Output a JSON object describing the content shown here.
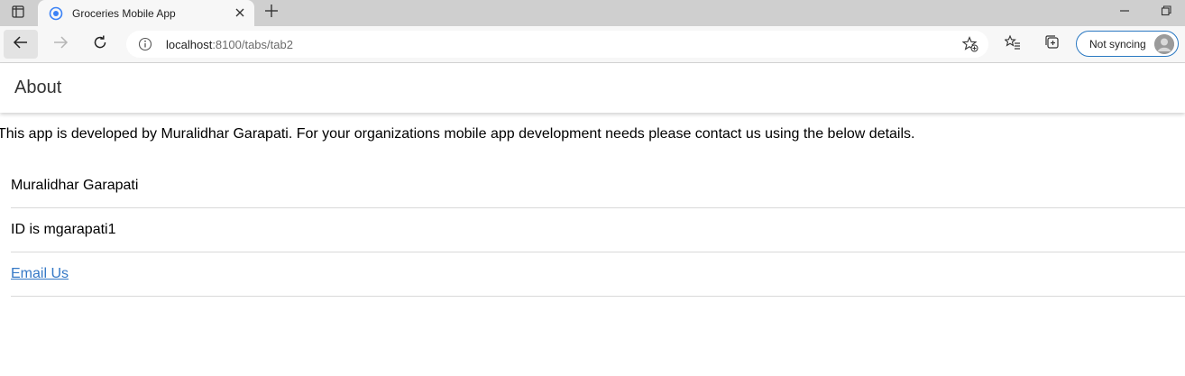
{
  "browser": {
    "tab": {
      "title": "Groceries Mobile App",
      "favicon": "ionic-icon"
    },
    "address": {
      "host": "localhost",
      "path": ":8100/tabs/tab2"
    },
    "profile": {
      "label": "Not syncing"
    },
    "colors": {
      "accent": "#2b79c2",
      "tab_strip": "#cfcfcf",
      "toolbar": "#f7f7f7"
    }
  },
  "page": {
    "title": "About",
    "intro": "This app is developed by Muralidhar Garapati. For your organizations mobile app development needs please contact us using the below details.",
    "items": [
      {
        "text": "Muralidhar Garapati"
      },
      {
        "text": "ID is mgarapati1"
      },
      {
        "text": "Email Us",
        "link": true
      }
    ],
    "colors": {
      "link": "#3478c6"
    }
  }
}
